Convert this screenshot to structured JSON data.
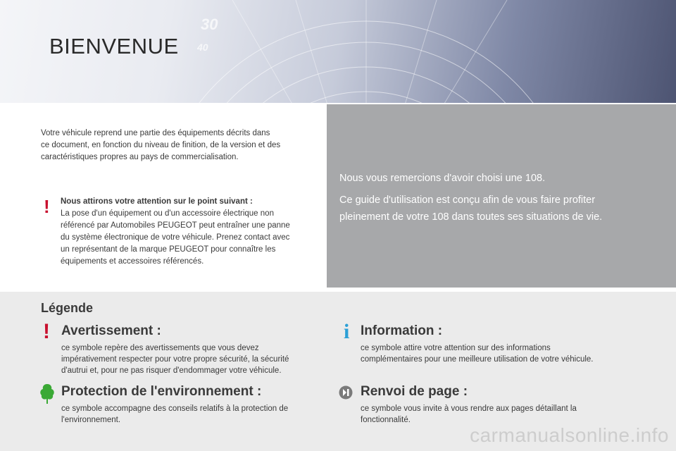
{
  "header": {
    "title": "BIENVENUE"
  },
  "intro": {
    "lines": [
      "Votre véhicule reprend une partie des équipements décrits dans",
      "ce document, en fonction du niveau de finition, de la version et des",
      "caractéristiques propres au pays de commercialisation."
    ]
  },
  "warning_note": {
    "symbol": "!",
    "heading": "Nous attirons votre attention sur le point suivant :",
    "lines": [
      "La pose d'un équipement ou d'un accessoire électrique non",
      "référencé par Automobiles PEUGEOT peut entraîner une panne",
      "du système électronique de votre véhicule. Prenez contact avec",
      "un représentant de la marque PEUGEOT pour connaître les",
      "équipements et accessoires référencés."
    ]
  },
  "panel": {
    "line1": "Nous vous remercions d'avoir choisi une 108.",
    "line2": "Ce guide d'utilisation est conçu afin de vous faire profiter",
    "line3": "pleinement de votre 108 dans toutes ses situations de vie."
  },
  "legend": {
    "title": "Légende",
    "items": [
      {
        "symbol": "!",
        "icon": "warning-icon",
        "heading": "Avertissement :",
        "lines": [
          "ce symbole repère des avertissements que vous devez",
          "impérativement respecter pour votre propre sécurité, la sécurité",
          "d'autrui et, pour ne pas risquer d'endommager votre véhicule."
        ]
      },
      {
        "symbol": "i",
        "icon": "information-icon",
        "heading": "Information :",
        "lines": [
          "ce symbole attire votre attention sur des informations",
          "complémentaires pour une meilleure utilisation de votre véhicule."
        ]
      },
      {
        "icon": "tree-icon",
        "heading": "Protection de l'environnement :",
        "lines": [
          "ce symbole accompagne des conseils relatifs à la protection de",
          "l'environnement."
        ]
      },
      {
        "icon": "page-reference-icon",
        "heading": "Renvoi de page :",
        "lines": [
          "ce symbole vous invite à vous rendre aux pages détaillant la",
          "fonctionnalité."
        ]
      }
    ]
  },
  "watermark": "carmanualsonline.info",
  "colors": {
    "warning_red": "#c8102e",
    "info_blue": "#2b9fd6",
    "env_green": "#3aa935",
    "panel_grey": "#a7a8aa",
    "legend_bg": "#ebebeb"
  }
}
